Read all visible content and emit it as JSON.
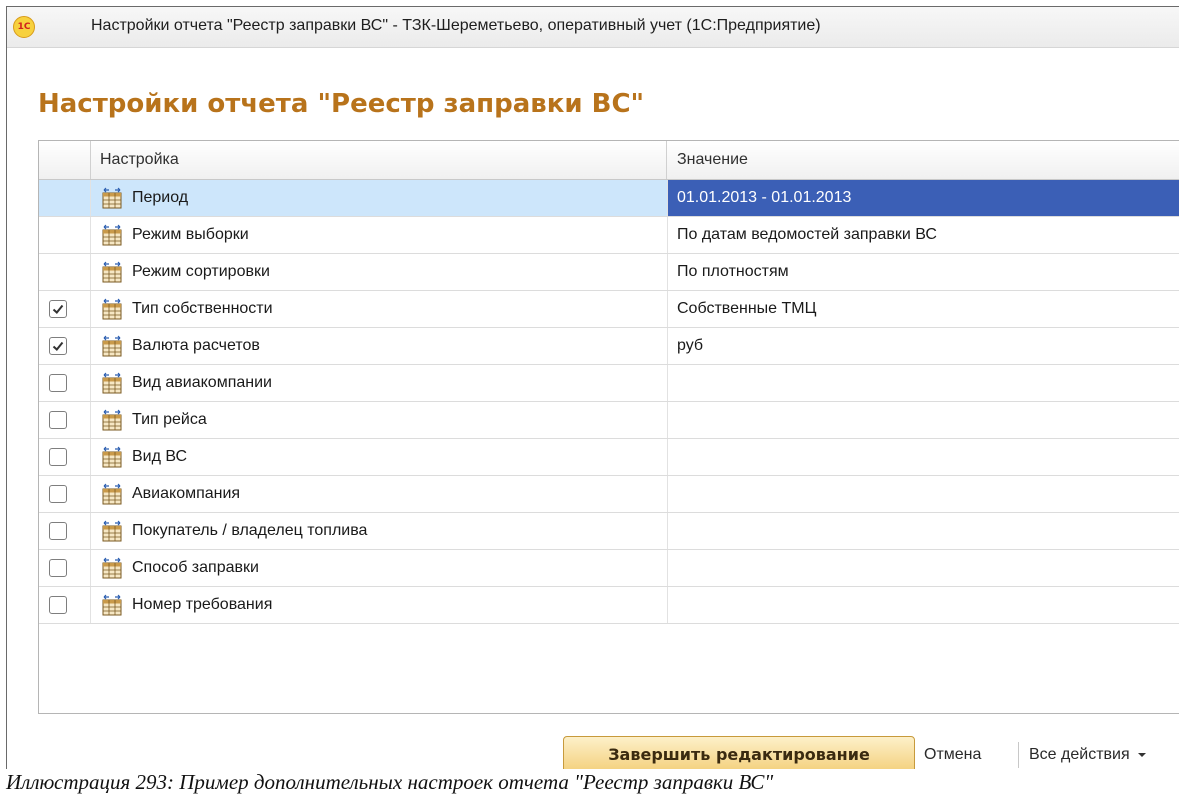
{
  "window": {
    "logo_text": "1C",
    "title": "Настройки отчета \"Реестр заправки ВС\" - ТЗК-Шереметьево, оперативный учет  (1С:Предприятие)"
  },
  "form": {
    "heading": "Настройки отчета \"Реестр заправки ВС\""
  },
  "grid": {
    "columns": {
      "setting": "Настройка",
      "value": "Значение"
    },
    "rows": [
      {
        "name": "Период",
        "value": "01.01.2013 - 01.01.2013",
        "checkbox": null,
        "selected": true
      },
      {
        "name": "Режим выборки",
        "value": "По датам ведомостей заправки ВС",
        "checkbox": null,
        "selected": false
      },
      {
        "name": "Режим сортировки",
        "value": "По плотностям",
        "checkbox": null,
        "selected": false
      },
      {
        "name": "Тип собственности",
        "value": "Собственные ТМЦ",
        "checkbox": true,
        "selected": false
      },
      {
        "name": "Валюта расчетов",
        "value": "руб",
        "checkbox": true,
        "selected": false
      },
      {
        "name": "Вид авиакомпании",
        "value": "",
        "checkbox": false,
        "selected": false
      },
      {
        "name": "Тип рейса",
        "value": "",
        "checkbox": false,
        "selected": false
      },
      {
        "name": "Вид ВС",
        "value": "",
        "checkbox": false,
        "selected": false
      },
      {
        "name": "Авиакомпания",
        "value": "",
        "checkbox": false,
        "selected": false
      },
      {
        "name": "Покупатель / владелец топлива",
        "value": "",
        "checkbox": false,
        "selected": false
      },
      {
        "name": "Способ заправки",
        "value": "",
        "checkbox": false,
        "selected": false
      },
      {
        "name": "Номер требования",
        "value": "",
        "checkbox": false,
        "selected": false
      }
    ]
  },
  "footer": {
    "finish": "Завершить редактирование",
    "cancel": "Отмена",
    "actions": "Все действия",
    "actions_icon": "dropdown-arrow-icon"
  },
  "caption": "Иллюстрация 293: Пример дополнительных настроек отчета \"Реестр заправки ВС\"",
  "colors": {
    "heading": "#b8731b",
    "selection_row": "#cde6fb",
    "selection_cell": "#3b5fb6",
    "finish_button": "#f3cf7a"
  }
}
